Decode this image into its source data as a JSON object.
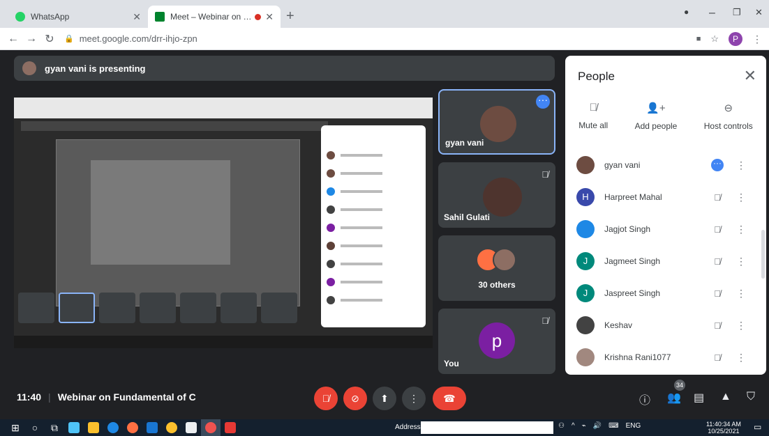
{
  "browser": {
    "tabs": [
      {
        "title": "WhatsApp",
        "active": false,
        "favicon_color": "#25d366"
      },
      {
        "title": "Meet – Webinar on Fundam",
        "active": true,
        "favicon_color": "#00832d"
      }
    ],
    "url": "meet.google.com/drr-ihjo-zpn",
    "profile_initial": "P"
  },
  "presenting_banner": "gyan vani is presenting",
  "tiles": {
    "t1_name": "gyan vani",
    "t2_name": "Sahil Gulati",
    "t3_label": "30 others",
    "t4_name": "You",
    "t4_initial": "p"
  },
  "people_panel": {
    "title": "People",
    "actions": [
      {
        "label": "Mute all",
        "icon": "mute-all-icon"
      },
      {
        "label": "Add people",
        "icon": "add-people-icon"
      },
      {
        "label": "Host controls",
        "icon": "host-controls-icon"
      }
    ],
    "participants": [
      {
        "name": "gyan vani",
        "initial": "",
        "color": "#6d4c41",
        "presenter": true
      },
      {
        "name": "Harpreet Mahal",
        "initial": "H",
        "color": "#3949ab"
      },
      {
        "name": "Jagjot Singh",
        "initial": "",
        "color": "#1e88e5"
      },
      {
        "name": "Jagmeet Singh",
        "initial": "J",
        "color": "#00897b"
      },
      {
        "name": "Jaspreet Singh",
        "initial": "J",
        "color": "#00897b"
      },
      {
        "name": "Keshav",
        "initial": "",
        "color": "#424242"
      },
      {
        "name": "Krishna Rani1077",
        "initial": "",
        "color": "#a1887f"
      }
    ]
  },
  "meeting": {
    "time": "11:40",
    "title": "Webinar on Fundamental of C",
    "participant_count": "34"
  },
  "taskbar": {
    "address_label": "Address",
    "language": "ENG",
    "clock_time": "11:40:34 AM",
    "clock_date": "10/25/2021"
  }
}
